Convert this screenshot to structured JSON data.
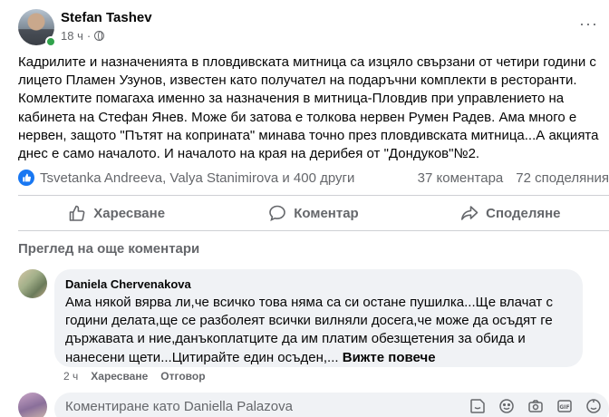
{
  "post": {
    "author": "Stefan Tashev",
    "time": "18 ч",
    "separator": "·",
    "body": "Кадрилите и назначенията в пловдивската  митница са изцяло свързани от четири години с\nлицето Пламен Узунов, известен като получател на подаръчни комплекти в ресторанти.\nКомлектите помагаха именно за назначения в митница-Пловдив при управлението на\nкабинета на Стефан Янев. Може би затова е толкова нервен Румен Радев. Ама много е\nнервен, защото \"Пътят на коприната\" минава точно през пловдивската митница...А акцията\nднес е  само началото. И началото на края на дерибея от \"Дондуков\"№2."
  },
  "stats": {
    "reactors": "Tsvetanka Andreeva, Valya Stanimirova и 400 други",
    "comments": "37 коментара",
    "shares": "72 споделяния"
  },
  "actions": {
    "like": "Харесване",
    "comment": "Коментар",
    "share": "Споделяне"
  },
  "comments": {
    "view_more": "Преглед на още коментари",
    "items": [
      {
        "author": "Daniela Chervenakova",
        "text": "Ама някой вярва ли,че всичко това няма са си остане пушилка...Ще влачат с години делата,ще се разболеят всички вилняли досега,че може да осъдят ге държавата и ние,данъкоплатците да им платим обезщетения за обида и нанесени щети...Цитирайте един осъден,... ",
        "see_more": "Вижте повече",
        "time": "2 ч",
        "like": "Харесване",
        "reply": "Отговор"
      }
    ]
  },
  "composer": {
    "placeholder": "Коментиране като Daniella Palazova"
  },
  "colors": {
    "brand": "#1877f2",
    "secondary_text": "#65676b",
    "bubble": "#f0f2f5",
    "online": "#31a24c"
  },
  "icons": [
    "globe-icon",
    "more-icon",
    "like-reaction-icon",
    "like-icon",
    "comment-icon",
    "share-icon",
    "sticker-icon",
    "emoji-icon",
    "camera-icon",
    "gif-icon",
    "sticker-pack-icon"
  ]
}
